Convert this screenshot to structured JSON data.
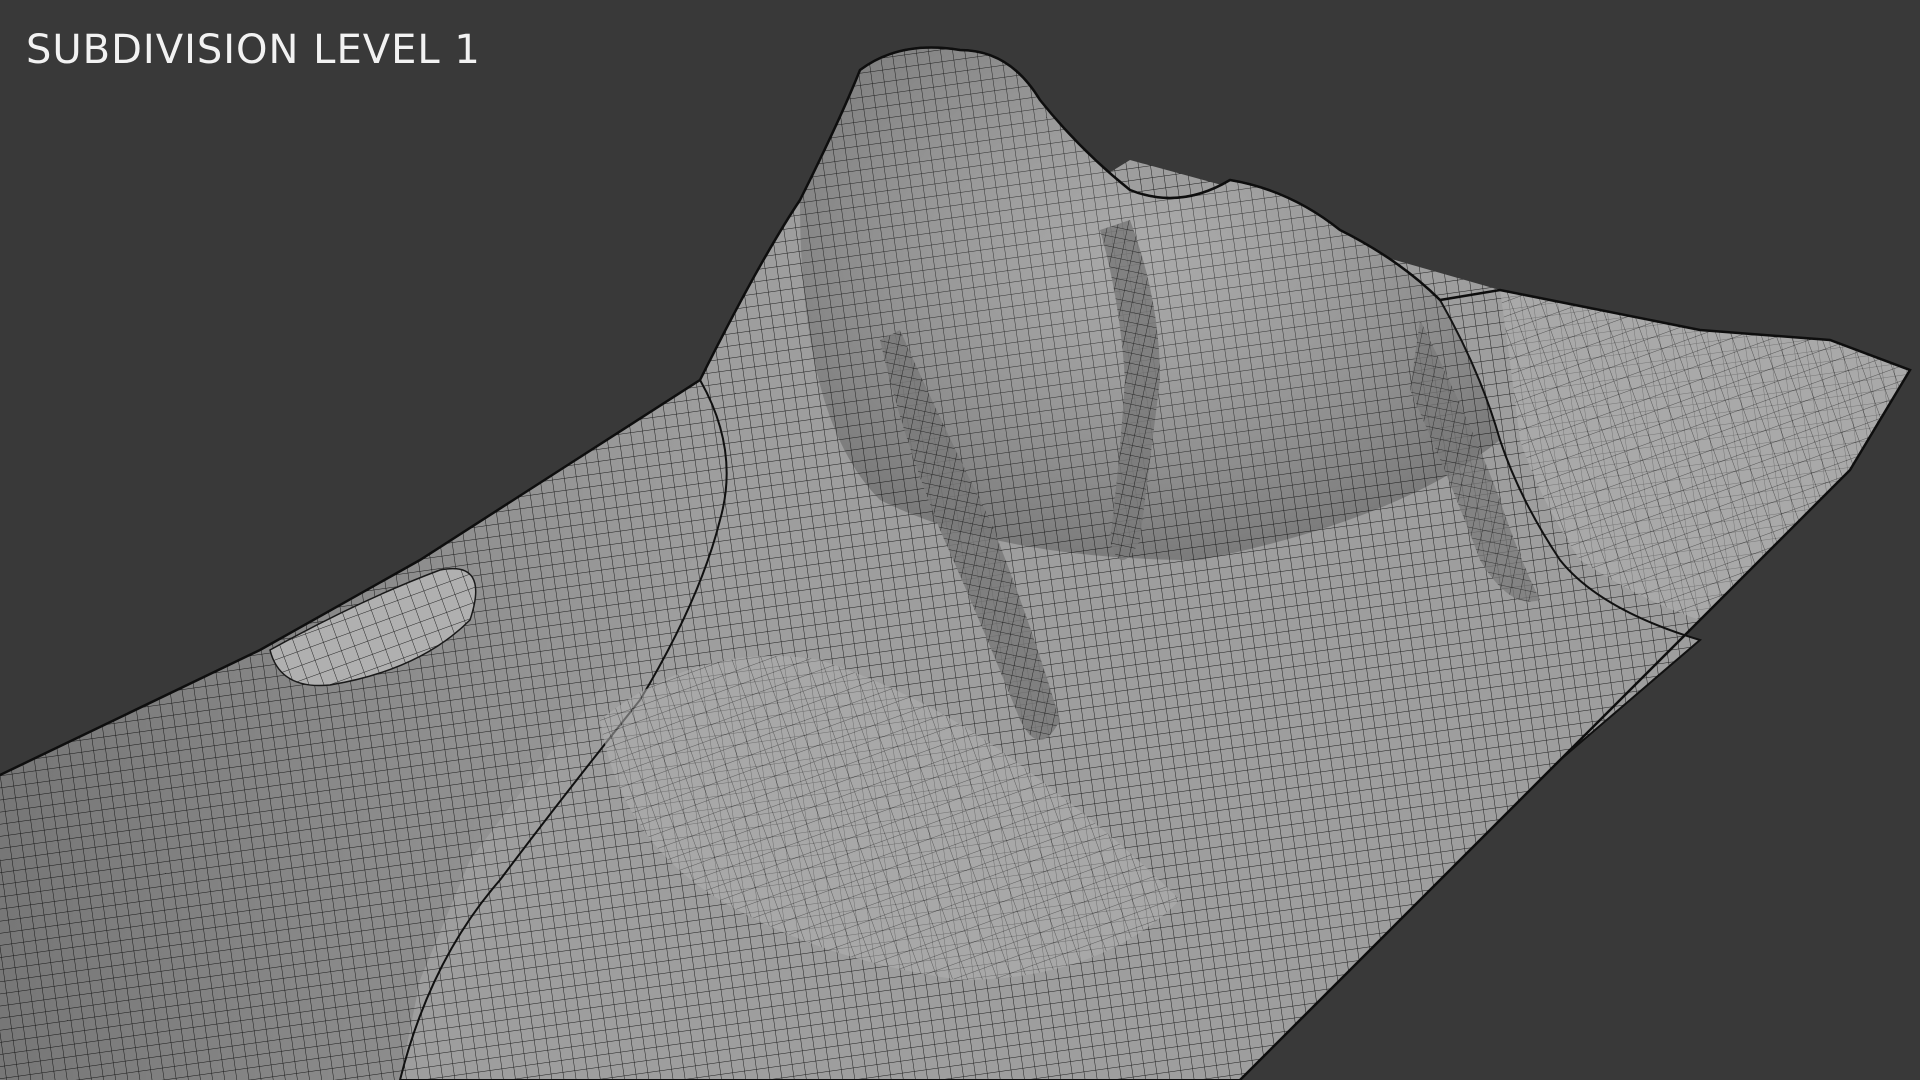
{
  "viewport": {
    "label": "SUBDIVISION LEVEL 1",
    "background_color": "#393939",
    "label_color": "#f2f2f2"
  },
  "mesh": {
    "object": "subdivided-terrain-wireframe",
    "surface_color": "#9d9d9d",
    "wire_color": "#1a1a1a"
  }
}
